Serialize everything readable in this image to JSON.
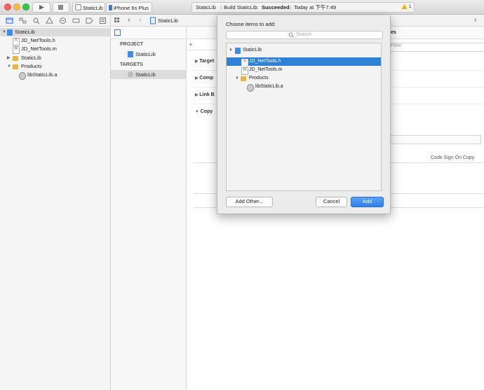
{
  "toolbar": {
    "scheme_target": "StaticLib",
    "scheme_device": "iPhone 6s Plus",
    "status_project": "StaticLib",
    "status_build_prefix": "Build StaticLib:",
    "status_build_result": "Succeeded",
    "status_time": "Today at 下午7:49",
    "warning_count": "1"
  },
  "jumpbar": {
    "file": "StaticLib"
  },
  "navigator": {
    "items": [
      {
        "label": "StaticLib",
        "icon": "project-icon"
      },
      {
        "label": "JD_NetTools.h",
        "icon": "header-file-icon"
      },
      {
        "label": "JD_NetTools.m",
        "icon": "source-file-icon"
      },
      {
        "label": "StaticLib",
        "icon": "folder-icon"
      },
      {
        "label": "Products",
        "icon": "folder-icon"
      },
      {
        "label": "libStaticLib.a",
        "icon": "library-icon"
      }
    ]
  },
  "project_pane": {
    "project_heading": "PROJECT",
    "project_item": "StaticLib",
    "targets_heading": "TARGETS",
    "target_item": "StaticLib"
  },
  "editor": {
    "tab_suffix": "es",
    "filter_placeholder": "Filter",
    "phases": [
      "Target",
      "Comp",
      "Link B",
      "Copy"
    ],
    "code_sign_label": "Code Sign On Copy"
  },
  "dialog": {
    "title": "Choose items to add:",
    "search_placeholder": "Search",
    "items": [
      {
        "label": "StaticLib"
      },
      {
        "label": "JD_NetTools.h"
      },
      {
        "label": "JD_NetTools.m"
      },
      {
        "label": "Products"
      },
      {
        "label": "libStaticLib.a"
      }
    ],
    "add_other_label": "Add Other...",
    "cancel_label": "Cancel",
    "add_label": "Add"
  },
  "colors": {
    "accent": "#3478f6",
    "selection": "#2f81d6",
    "folder": "#e8b542",
    "warning": "#f0b400",
    "close": "#fc605c",
    "minimize": "#fdbc40",
    "zoom": "#34c84a"
  }
}
